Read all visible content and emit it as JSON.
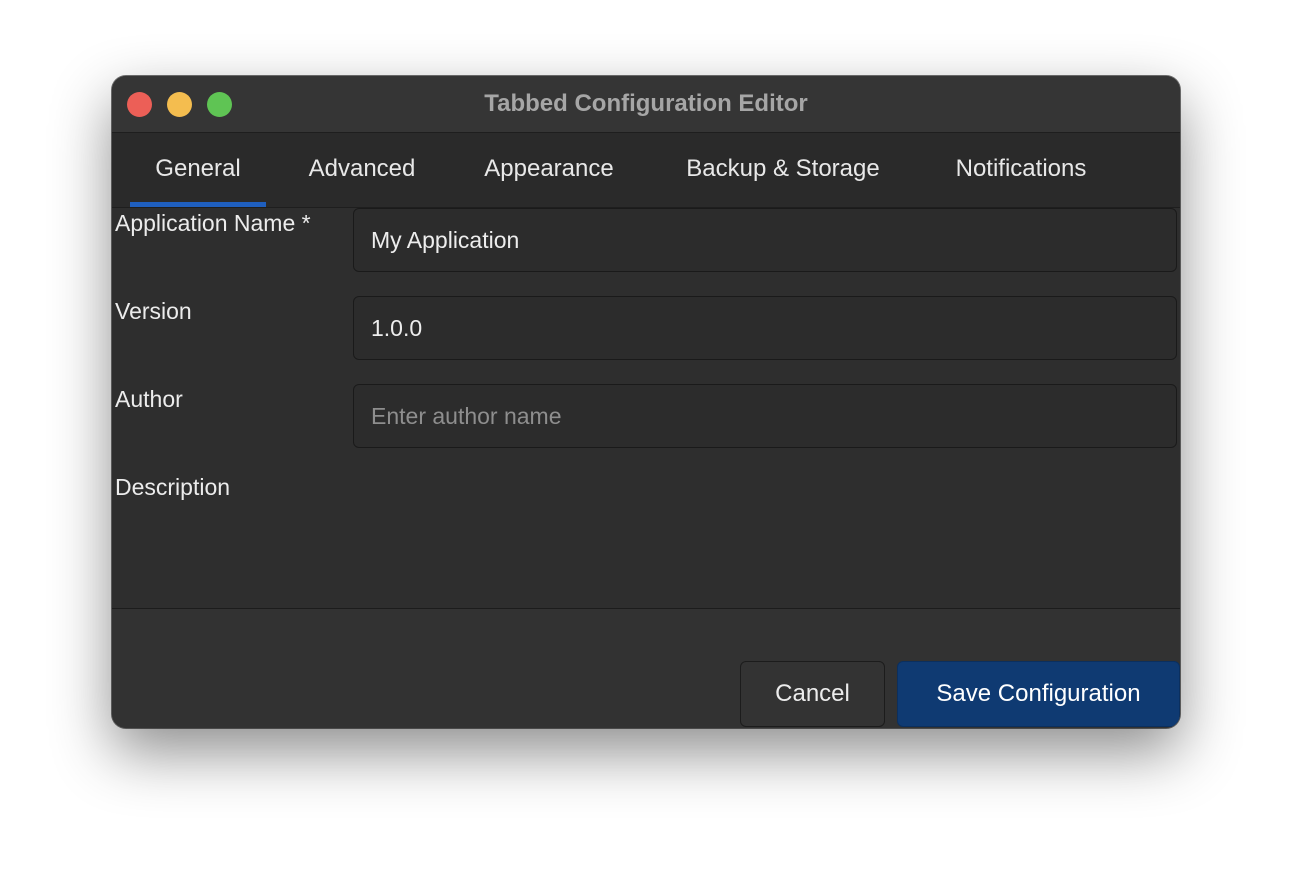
{
  "window": {
    "title": "Tabbed Configuration Editor",
    "traffic_lights": {
      "close_color": "#ec5f57",
      "minimize_color": "#f4bd4f",
      "zoom_color": "#5fc454"
    }
  },
  "tabs": [
    {
      "label": "General",
      "active": true
    },
    {
      "label": "Advanced",
      "active": false
    },
    {
      "label": "Appearance",
      "active": false
    },
    {
      "label": "Backup & Storage",
      "active": false
    },
    {
      "label": "Notifications",
      "active": false
    }
  ],
  "accent_color": "#1f5fbf",
  "form": {
    "app_name": {
      "label": "Application Name *",
      "value": "My Application"
    },
    "version": {
      "label": "Version",
      "value": "1.0.0"
    },
    "author": {
      "label": "Author",
      "value": "",
      "placeholder": "Enter author name"
    },
    "description": {
      "label": "Description"
    }
  },
  "buttons": {
    "cancel": "Cancel",
    "save": "Save Configuration"
  }
}
